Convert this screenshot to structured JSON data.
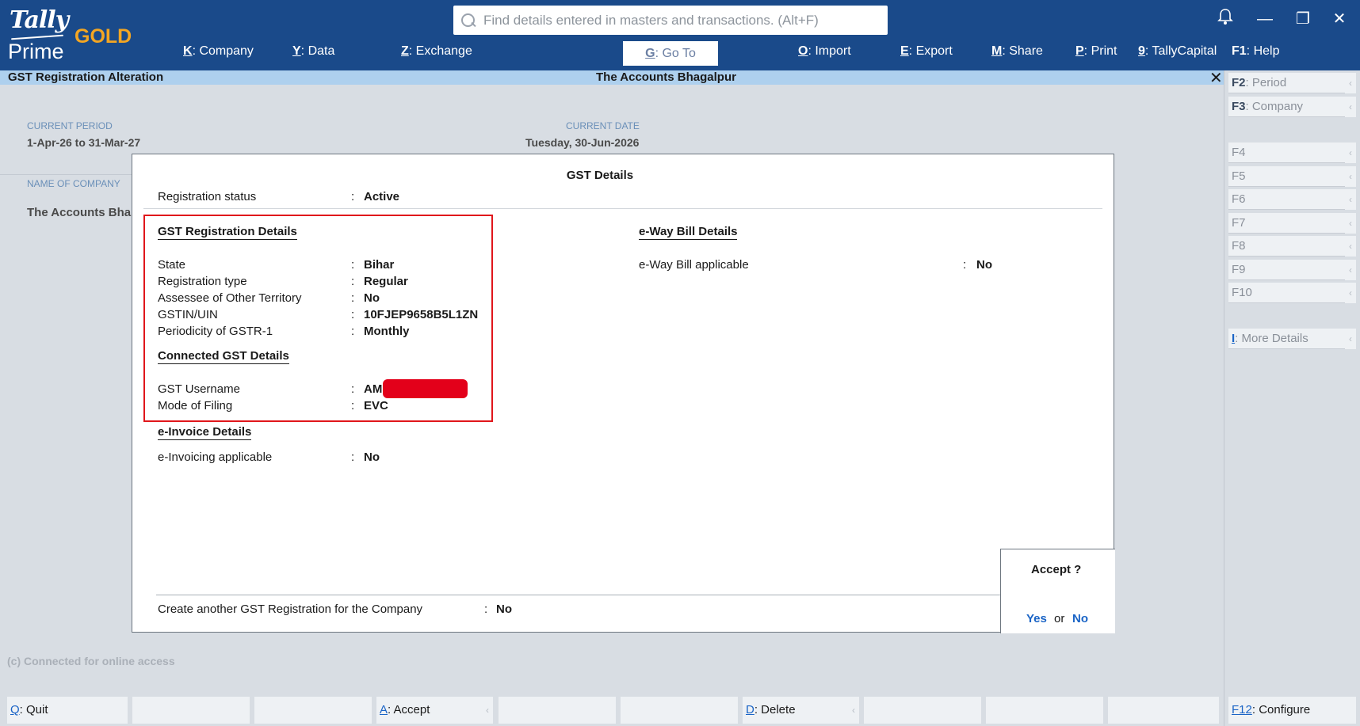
{
  "logo": {
    "tally": "Tally",
    "prime": "Prime",
    "edition": "GOLD"
  },
  "search": {
    "placeholder": "Find details entered in masters and transactions. (Alt+F)"
  },
  "menu": [
    {
      "key": "K",
      "label": ": Company"
    },
    {
      "key": "Y",
      "label": ": Data"
    },
    {
      "key": "Z",
      "label": ": Exchange"
    },
    {
      "key": "G",
      "label": ": Go To"
    },
    {
      "key": "O",
      "label": ": Import"
    },
    {
      "key": "E",
      "label": ": Export"
    },
    {
      "key": "M",
      "label": ": Share"
    },
    {
      "key": "P",
      "label": ": Print"
    },
    {
      "key": "9",
      "label": ": TallyCapital"
    },
    {
      "key": "F1",
      "label": ": Help"
    }
  ],
  "titlebar": {
    "screen": "GST Registration Alteration",
    "company": "The Accounts Bhagalpur"
  },
  "background": {
    "current_period_label": "CURRENT PERIOD",
    "current_period": "1-Apr-26 to 31-Mar-27",
    "current_date_label": "CURRENT DATE",
    "current_date": "Tuesday, 30-Jun-2026",
    "company_label": "NAME OF COMPANY",
    "company_value": "The Accounts Bha",
    "footnote": "(c) Connected for online access"
  },
  "dialog": {
    "title": "GST Details",
    "registration_status_label": "Registration status",
    "registration_status": "Active",
    "gst_reg_heading": "GST Registration Details",
    "fields": [
      {
        "label": "State",
        "value": "Bihar"
      },
      {
        "label": "Registration type",
        "value": "Regular"
      },
      {
        "label": "Assessee of Other Territory",
        "value": "No"
      },
      {
        "label": "GSTIN/UIN",
        "value": "10FJEP9658B5L1ZN"
      },
      {
        "label": "Periodicity of GSTR-1",
        "value": "Monthly"
      }
    ],
    "connected_heading": "Connected GST Details",
    "connected_fields": [
      {
        "label": "GST Username",
        "value": "AM"
      },
      {
        "label": "Mode of Filing",
        "value": "EVC"
      }
    ],
    "einvoice_heading": "e-Invoice Details",
    "einvoice_label": "e-Invoicing applicable",
    "einvoice_value": "No",
    "eway_heading": "e-Way Bill Details",
    "eway_label": "e-Way Bill applicable",
    "eway_value": "No",
    "another_label": "Create another GST Registration for the Company",
    "another_value": "No",
    "colon": ":"
  },
  "accept": {
    "question": "Accept ?",
    "yes": "Yes",
    "or": "or",
    "no": "No"
  },
  "right_panel": [
    {
      "key": "F2",
      "label": ": Period"
    },
    {
      "key": "F3",
      "label": ": Company"
    },
    {
      "key": "F4",
      "label": ""
    },
    {
      "key": "F5",
      "label": ""
    },
    {
      "key": "F6",
      "label": ""
    },
    {
      "key": "F7",
      "label": ""
    },
    {
      "key": "F8",
      "label": ""
    },
    {
      "key": "F9",
      "label": ""
    },
    {
      "key": "F10",
      "label": ""
    },
    {
      "key": "I",
      "label": ": More Details"
    }
  ],
  "bottom_bar": [
    {
      "key": "Q",
      "label": ": Quit"
    },
    {
      "key": "A",
      "label": ": Accept"
    },
    {
      "key": "D",
      "label": ": Delete"
    }
  ],
  "configure": {
    "key": "F12",
    "label": ": Configure"
  },
  "colors": {
    "header": "#1a4a8a",
    "titlebar": "#aed0ee",
    "accent_gold": "#f4a622",
    "link_blue": "#1a64c6",
    "highlight_red": "#e0161b"
  }
}
